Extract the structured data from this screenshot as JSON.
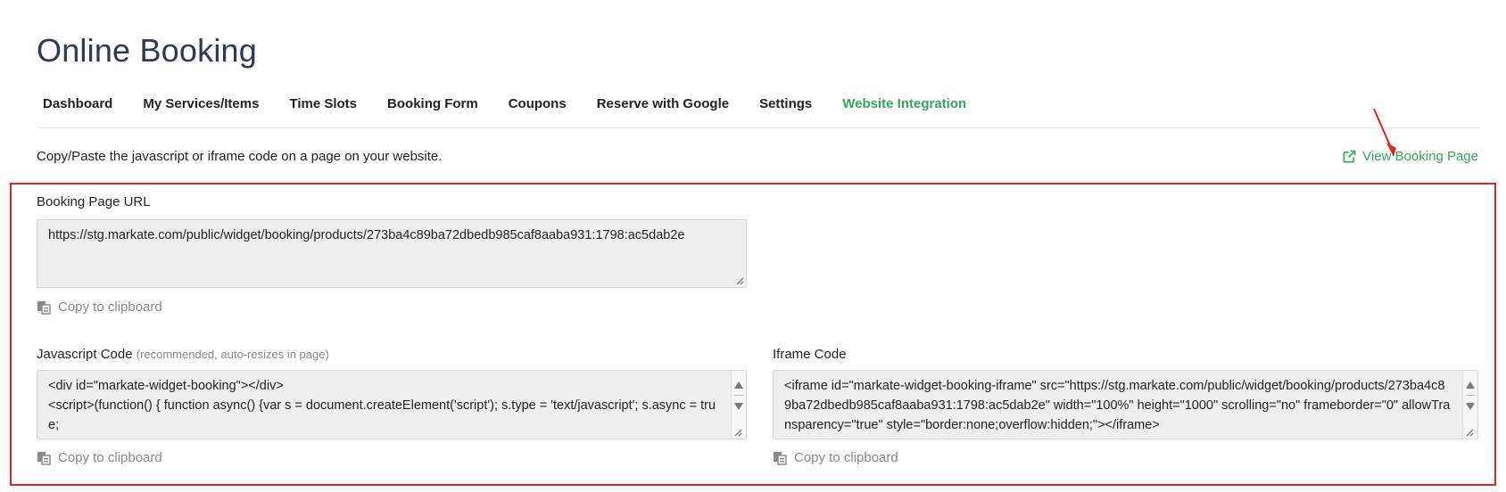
{
  "header": {
    "title": "Online Booking"
  },
  "tabs": [
    {
      "label": "Dashboard",
      "active": false
    },
    {
      "label": "My Services/Items",
      "active": false
    },
    {
      "label": "Time Slots",
      "active": false
    },
    {
      "label": "Booking Form",
      "active": false
    },
    {
      "label": "Coupons",
      "active": false
    },
    {
      "label": "Reserve with Google",
      "active": false
    },
    {
      "label": "Settings",
      "active": false
    },
    {
      "label": "Website Integration",
      "active": true
    }
  ],
  "intro": "Copy/Paste the javascript or iframe code on a page on your website.",
  "view_link": {
    "label": "View Booking Page",
    "icon": "external-link-icon",
    "color": "#2fa85a"
  },
  "booking_url": {
    "label": "Booking Page URL",
    "value": "https://stg.markate.com/public/widget/booking/products/273ba4c89ba72dbedb985caf8aaba931:1798:ac5dab2e",
    "copy_label": "Copy to clipboard"
  },
  "javascript": {
    "label": "Javascript Code",
    "hint": "(recommended, auto-resizes in page)",
    "value": "<div id=\"markate-widget-booking\"></div>\n<script>(function() { function async() {var s = document.createElement('script'); s.type = 'text/javascript'; s.async = true;\n  s.src = ('https:' == document.location.protocol ? 'https://' : 'http://') + 'stg.markate.com/public/widget/booking/js/",
    "copy_label": "Copy to clipboard"
  },
  "iframe": {
    "label": "Iframe Code",
    "value": "<iframe id=\"markate-widget-booking-iframe\" src=\"https://stg.markate.com/public/widget/booking/products/273ba4c89ba72dbedb985caf8aaba931:1798:ac5dab2e\" width=\"100%\" height=\"1000\" scrolling=\"no\" frameborder=\"0\" allowTransparency=\"true\" style=\"border:none;overflow:hidden;\"></iframe>",
    "copy_label": "Copy to clipboard"
  },
  "colors": {
    "accent": "#2fa85a",
    "title": "#2c3a57",
    "annotation": "#e02424"
  }
}
